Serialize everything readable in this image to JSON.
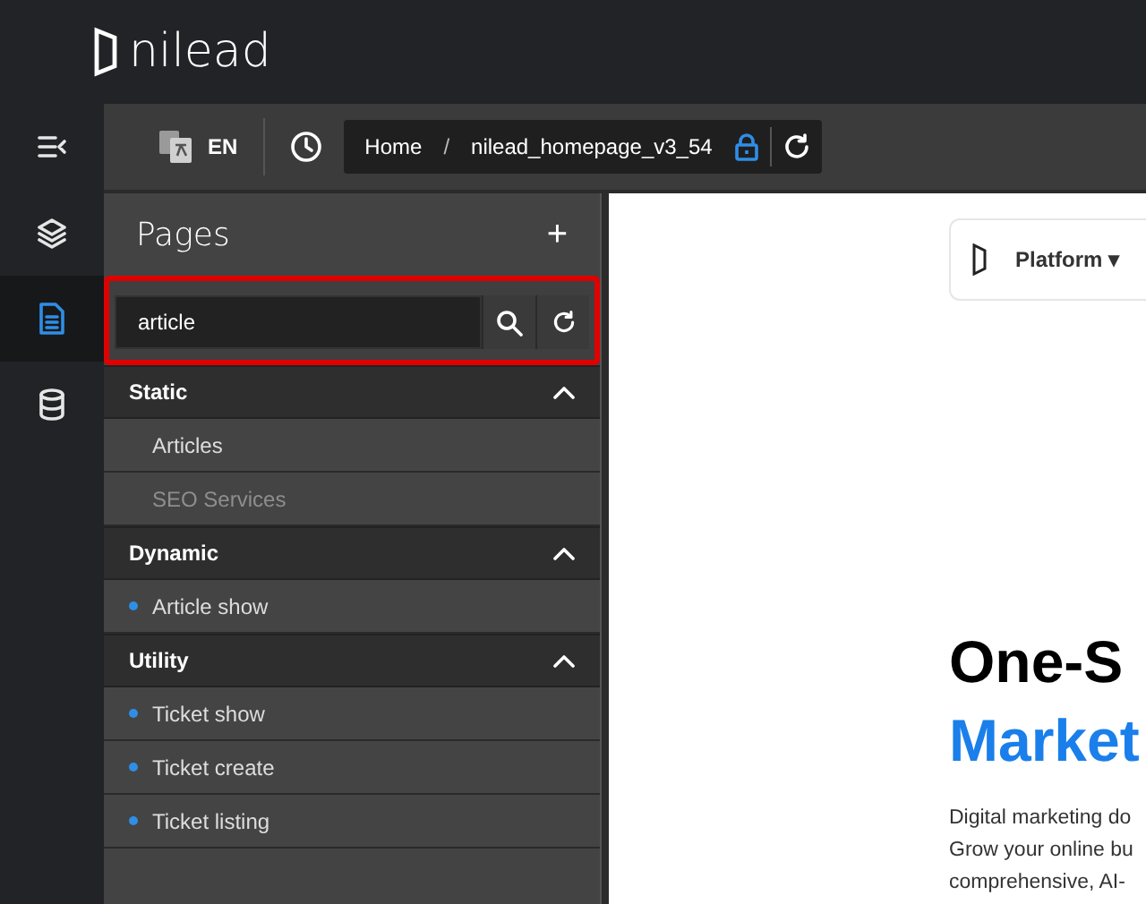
{
  "header": {
    "logo": "nilead"
  },
  "rail": [
    {
      "kind": "menu",
      "selected": false
    },
    {
      "kind": "layers",
      "selected": false
    },
    {
      "kind": "pages",
      "selected": true
    },
    {
      "kind": "database",
      "selected": false
    }
  ],
  "toolbar": {
    "language": "EN",
    "breadcrumb": [
      "Home",
      "/",
      "nilead_homepage_v3_54"
    ],
    "locked": true
  },
  "panel": {
    "title": "Pages",
    "add": "+",
    "search": {
      "value": "article",
      "highlighted": true
    },
    "groups": [
      {
        "label": "Static",
        "expanded": true,
        "items": [
          {
            "label": "Articles",
            "indicator": false,
            "disabled": false
          },
          {
            "label": "SEO Services",
            "indicator": false,
            "disabled": true
          }
        ]
      },
      {
        "label": "Dynamic",
        "expanded": true,
        "items": [
          {
            "label": "Article show",
            "indicator": true,
            "disabled": false
          }
        ]
      },
      {
        "label": "Utility",
        "expanded": true,
        "items": [
          {
            "label": "Ticket show",
            "indicator": true,
            "disabled": false
          },
          {
            "label": "Ticket create",
            "indicator": true,
            "disabled": false
          },
          {
            "label": "Ticket listing",
            "indicator": true,
            "disabled": false
          }
        ]
      }
    ]
  },
  "preview": {
    "nav": "Platform ▾",
    "headline": "One-S",
    "headline_accent": "Market",
    "body": [
      "Digital marketing do",
      "Grow your online bu",
      "comprehensive, AI-"
    ]
  }
}
